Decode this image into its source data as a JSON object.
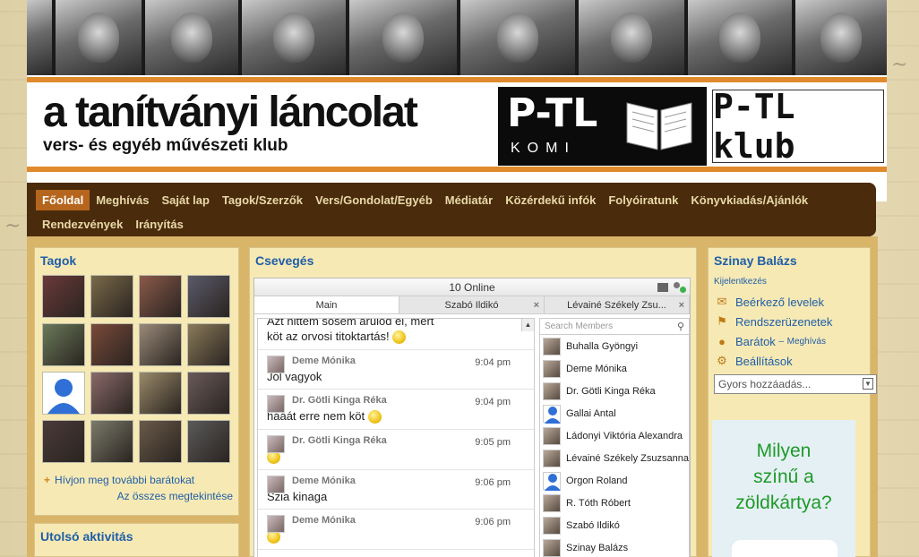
{
  "header": {
    "title": "a tanítványi láncolat",
    "subtitle": "vers- és egyéb művészeti klub",
    "logo_left_big": "P-TL",
    "logo_left_small": "KOMI",
    "logo_right": "P-TL klub"
  },
  "nav": {
    "row1": [
      "Főoldal",
      "Meghívás",
      "Saját lap",
      "Tagok/Szerzők",
      "Vers/Gondolat/Egyéb",
      "Médiatár",
      "Közérdekű infók",
      "Folyóiratunk",
      "Könyvkiadás/Ajánlók"
    ],
    "row2": [
      "Rendezvények",
      "Irányítás"
    ]
  },
  "members_panel": {
    "title": "Tagok",
    "invite_link": "Hívjon meg további barátokat",
    "view_all_link": "Az összes megtekintése"
  },
  "activity_panel": {
    "title": "Utolsó aktivitás"
  },
  "chat": {
    "title": "Csevegés",
    "online": "10 Online",
    "tabs": [
      "Main",
      "Szabó Ildikó",
      "Lévainé Székely Zsu..."
    ],
    "search_placeholder": "Search Members",
    "first_line": "Azt hittem sosem árulod el, mert",
    "second_line": "köt az orvosi titoktartás!",
    "messages": [
      {
        "name": "Deme Mónika",
        "time": "9:04 pm",
        "text": "Jól vagyok"
      },
      {
        "name": "Dr. Götli Kinga Réka",
        "time": "9:04 pm",
        "text": "hááát erre nem köt"
      },
      {
        "name": "Dr. Götli Kinga Réka",
        "time": "9:05 pm",
        "text": ""
      },
      {
        "name": "Deme Mónika",
        "time": "9:06 pm",
        "text": "Szia kinaga"
      },
      {
        "name": "Deme Mónika",
        "time": "9:06 pm",
        "text": ""
      }
    ],
    "members": [
      "Buhalla Gyöngyi",
      "Deme Mónika",
      "Dr. Götli Kinga Réka",
      "Gallai Antal",
      "Ládonyi Viktória Alexandra",
      "Lévainé Székely Zsuzsanna",
      "Orgon Roland",
      "R. Tóth Róbert",
      "Szabó Ildikó",
      "Szinay Balázs"
    ]
  },
  "user_panel": {
    "name": "Szinay Balázs",
    "logout": "Kijelentkezés",
    "inbox": "Beérkező levelek",
    "system_messages": "Rendszerüzenetek",
    "friends": "Barátok",
    "friends_sep": "–",
    "invitations": "Meghívás",
    "settings": "Beállítások",
    "quick_add": "Gyors hozzáadás...",
    "poll_line1": "Milyen",
    "poll_line2": "színű a",
    "poll_line3": "zöldkártya?"
  },
  "colors": {
    "accent": "#e08a2c",
    "nav_bg": "#4a2b0c",
    "link": "#1f5ea8",
    "panel_bg": "#f6e9b4"
  }
}
